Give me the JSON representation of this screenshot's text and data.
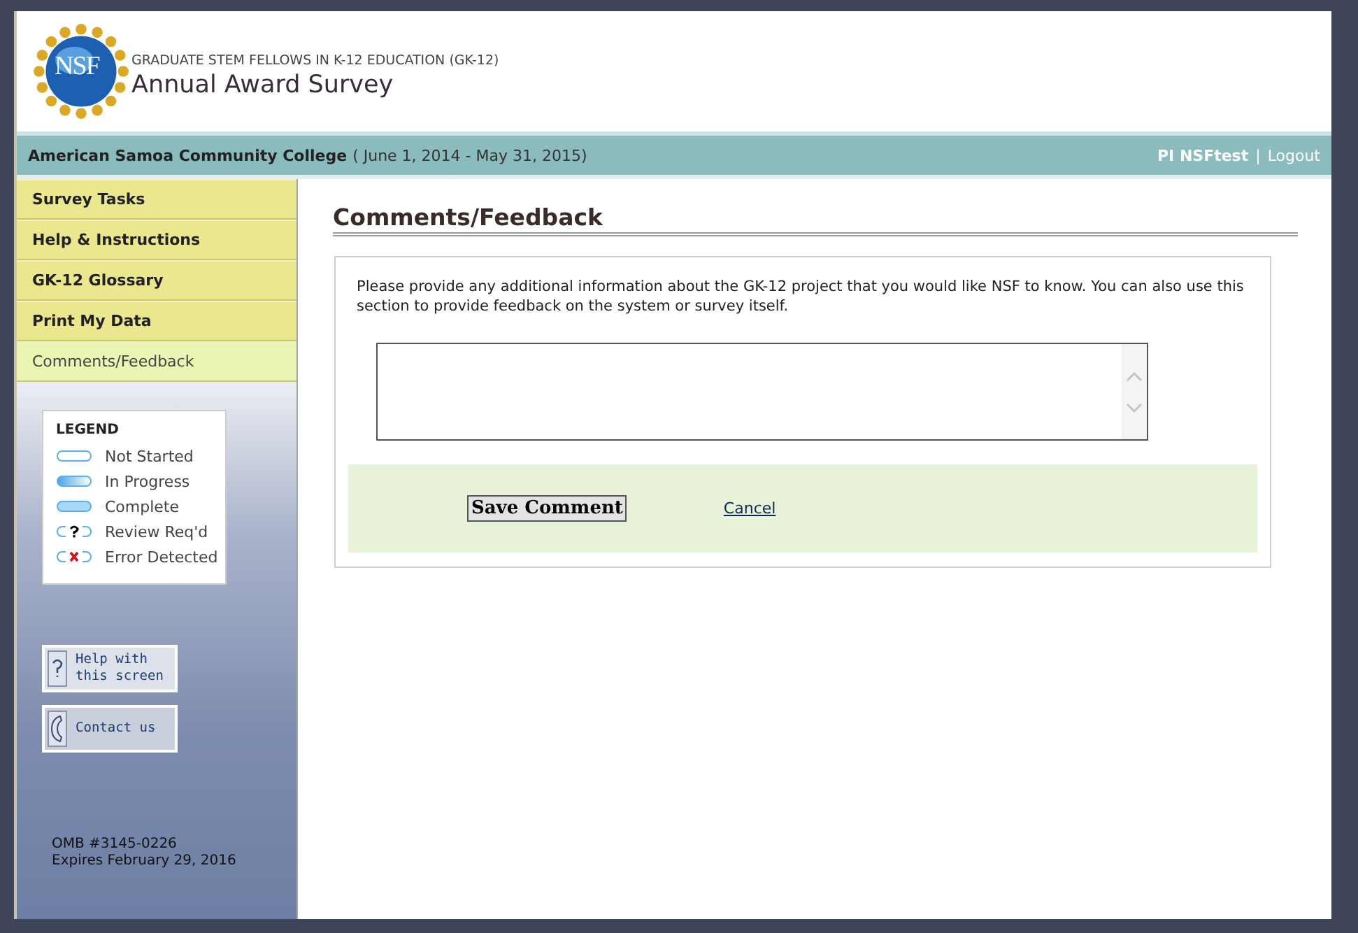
{
  "header": {
    "logo_text": "NSF",
    "program": "GRADUATE STEM FELLOWS IN K-12 EDUCATION (GK-12)",
    "title": "Annual Award Survey"
  },
  "info_bar": {
    "institution": "American Samoa Community College",
    "period": "( June 1, 2014 - May 31, 2015)",
    "user": "PI NSFtest",
    "separator": "|",
    "logout": "Logout"
  },
  "sidebar": {
    "items": [
      {
        "label": "Survey Tasks",
        "selected": false
      },
      {
        "label": "Help & Instructions",
        "selected": false
      },
      {
        "label": "GK-12 Glossary",
        "selected": false
      },
      {
        "label": "Print My Data",
        "selected": false
      },
      {
        "label": "Comments/Feedback",
        "selected": true
      }
    ],
    "legend": {
      "title": "LEGEND",
      "items": [
        {
          "kind": "not_started",
          "label": "Not Started"
        },
        {
          "kind": "in_progress",
          "label": "In Progress"
        },
        {
          "kind": "complete",
          "label": "Complete"
        },
        {
          "kind": "review",
          "label": "Review Req'd"
        },
        {
          "kind": "error",
          "label": "Error Detected"
        }
      ]
    },
    "buttons": [
      {
        "kind": "help",
        "label": "Help with this screen"
      },
      {
        "kind": "contact",
        "label": "Contact us"
      }
    ],
    "omb": "OMB #3145-0226",
    "expires": "Expires February 29, 2016"
  },
  "main": {
    "heading": "Comments/Feedback",
    "instructions": "Please provide any additional information about the GK-12 project that you would like NSF to know. You can also use this section to provide feedback on the system or survey itself.",
    "save_button": "Save Comment",
    "cancel_link": "Cancel"
  }
}
